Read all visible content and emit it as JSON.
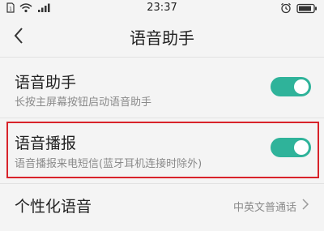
{
  "status_bar": {
    "time": "23:37",
    "left_icons": [
      "sim-icon",
      "wifi-icon",
      "signal-icon"
    ],
    "right_icons": [
      "alarm-icon",
      "battery-icon"
    ]
  },
  "header": {
    "title": "语音助手"
  },
  "settings": [
    {
      "label": "语音助手",
      "sub": "长按主屏幕按钮启动语音助手",
      "toggle": "on"
    },
    {
      "label": "语音播报",
      "sub": "语音播报来电短信(蓝牙耳机连接时除外)",
      "toggle": "on",
      "highlighted": true
    },
    {
      "label": "个性化语音",
      "value": "中英文普通话"
    }
  ],
  "colors": {
    "accent": "#2fb39a",
    "highlight_border": "#d8232a",
    "background": "#f4f4f4"
  }
}
